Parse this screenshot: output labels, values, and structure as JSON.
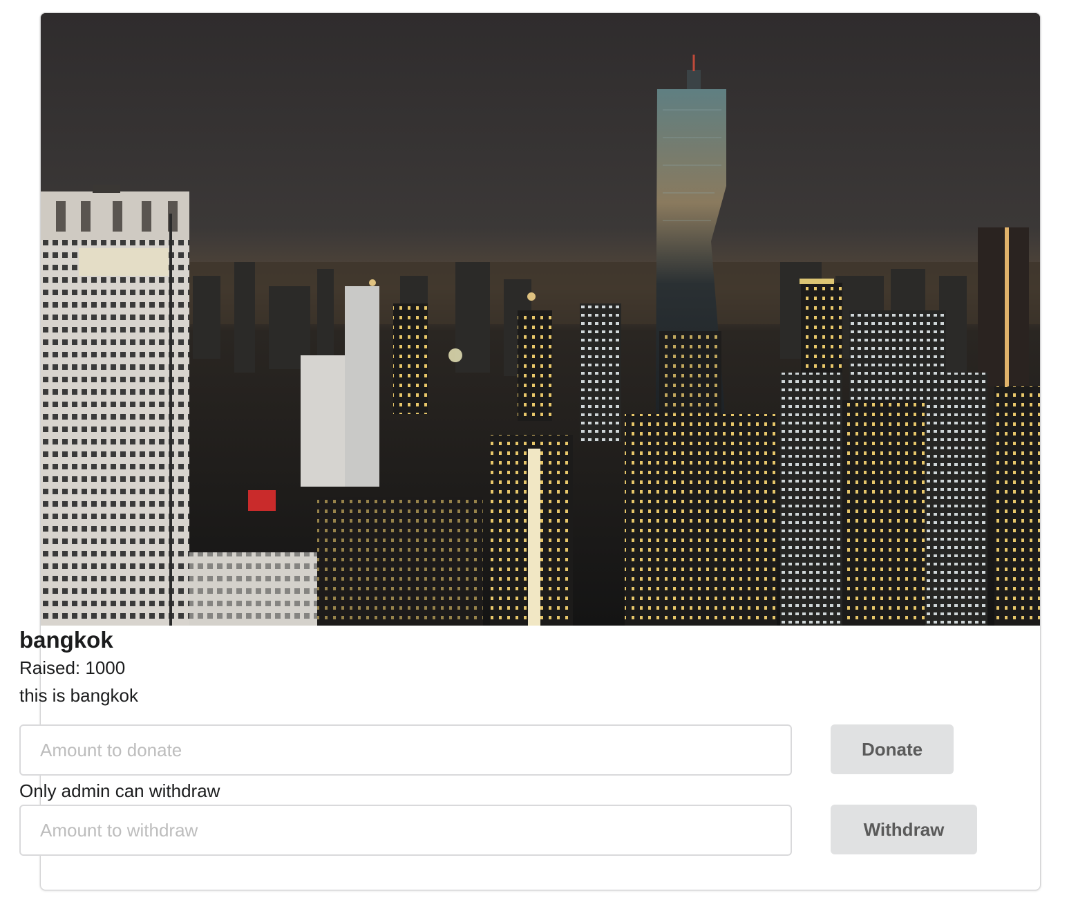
{
  "campaign": {
    "name": "bangkok",
    "raised_text": "Raised: 1000",
    "description": "this is bangkok",
    "image_alt": "Bangkok city skyline at night"
  },
  "donate": {
    "placeholder": "Amount to donate",
    "button_label": "Donate"
  },
  "withdraw": {
    "note": "Only admin can withdraw",
    "placeholder": "Amount to withdraw",
    "button_label": "Withdraw"
  },
  "colors": {
    "sky": "#3a3737",
    "button_bg": "#e0e1e2",
    "button_text": "#5a5a5a",
    "text": "#1b1c1d",
    "placeholder": "#bdbdbd"
  }
}
